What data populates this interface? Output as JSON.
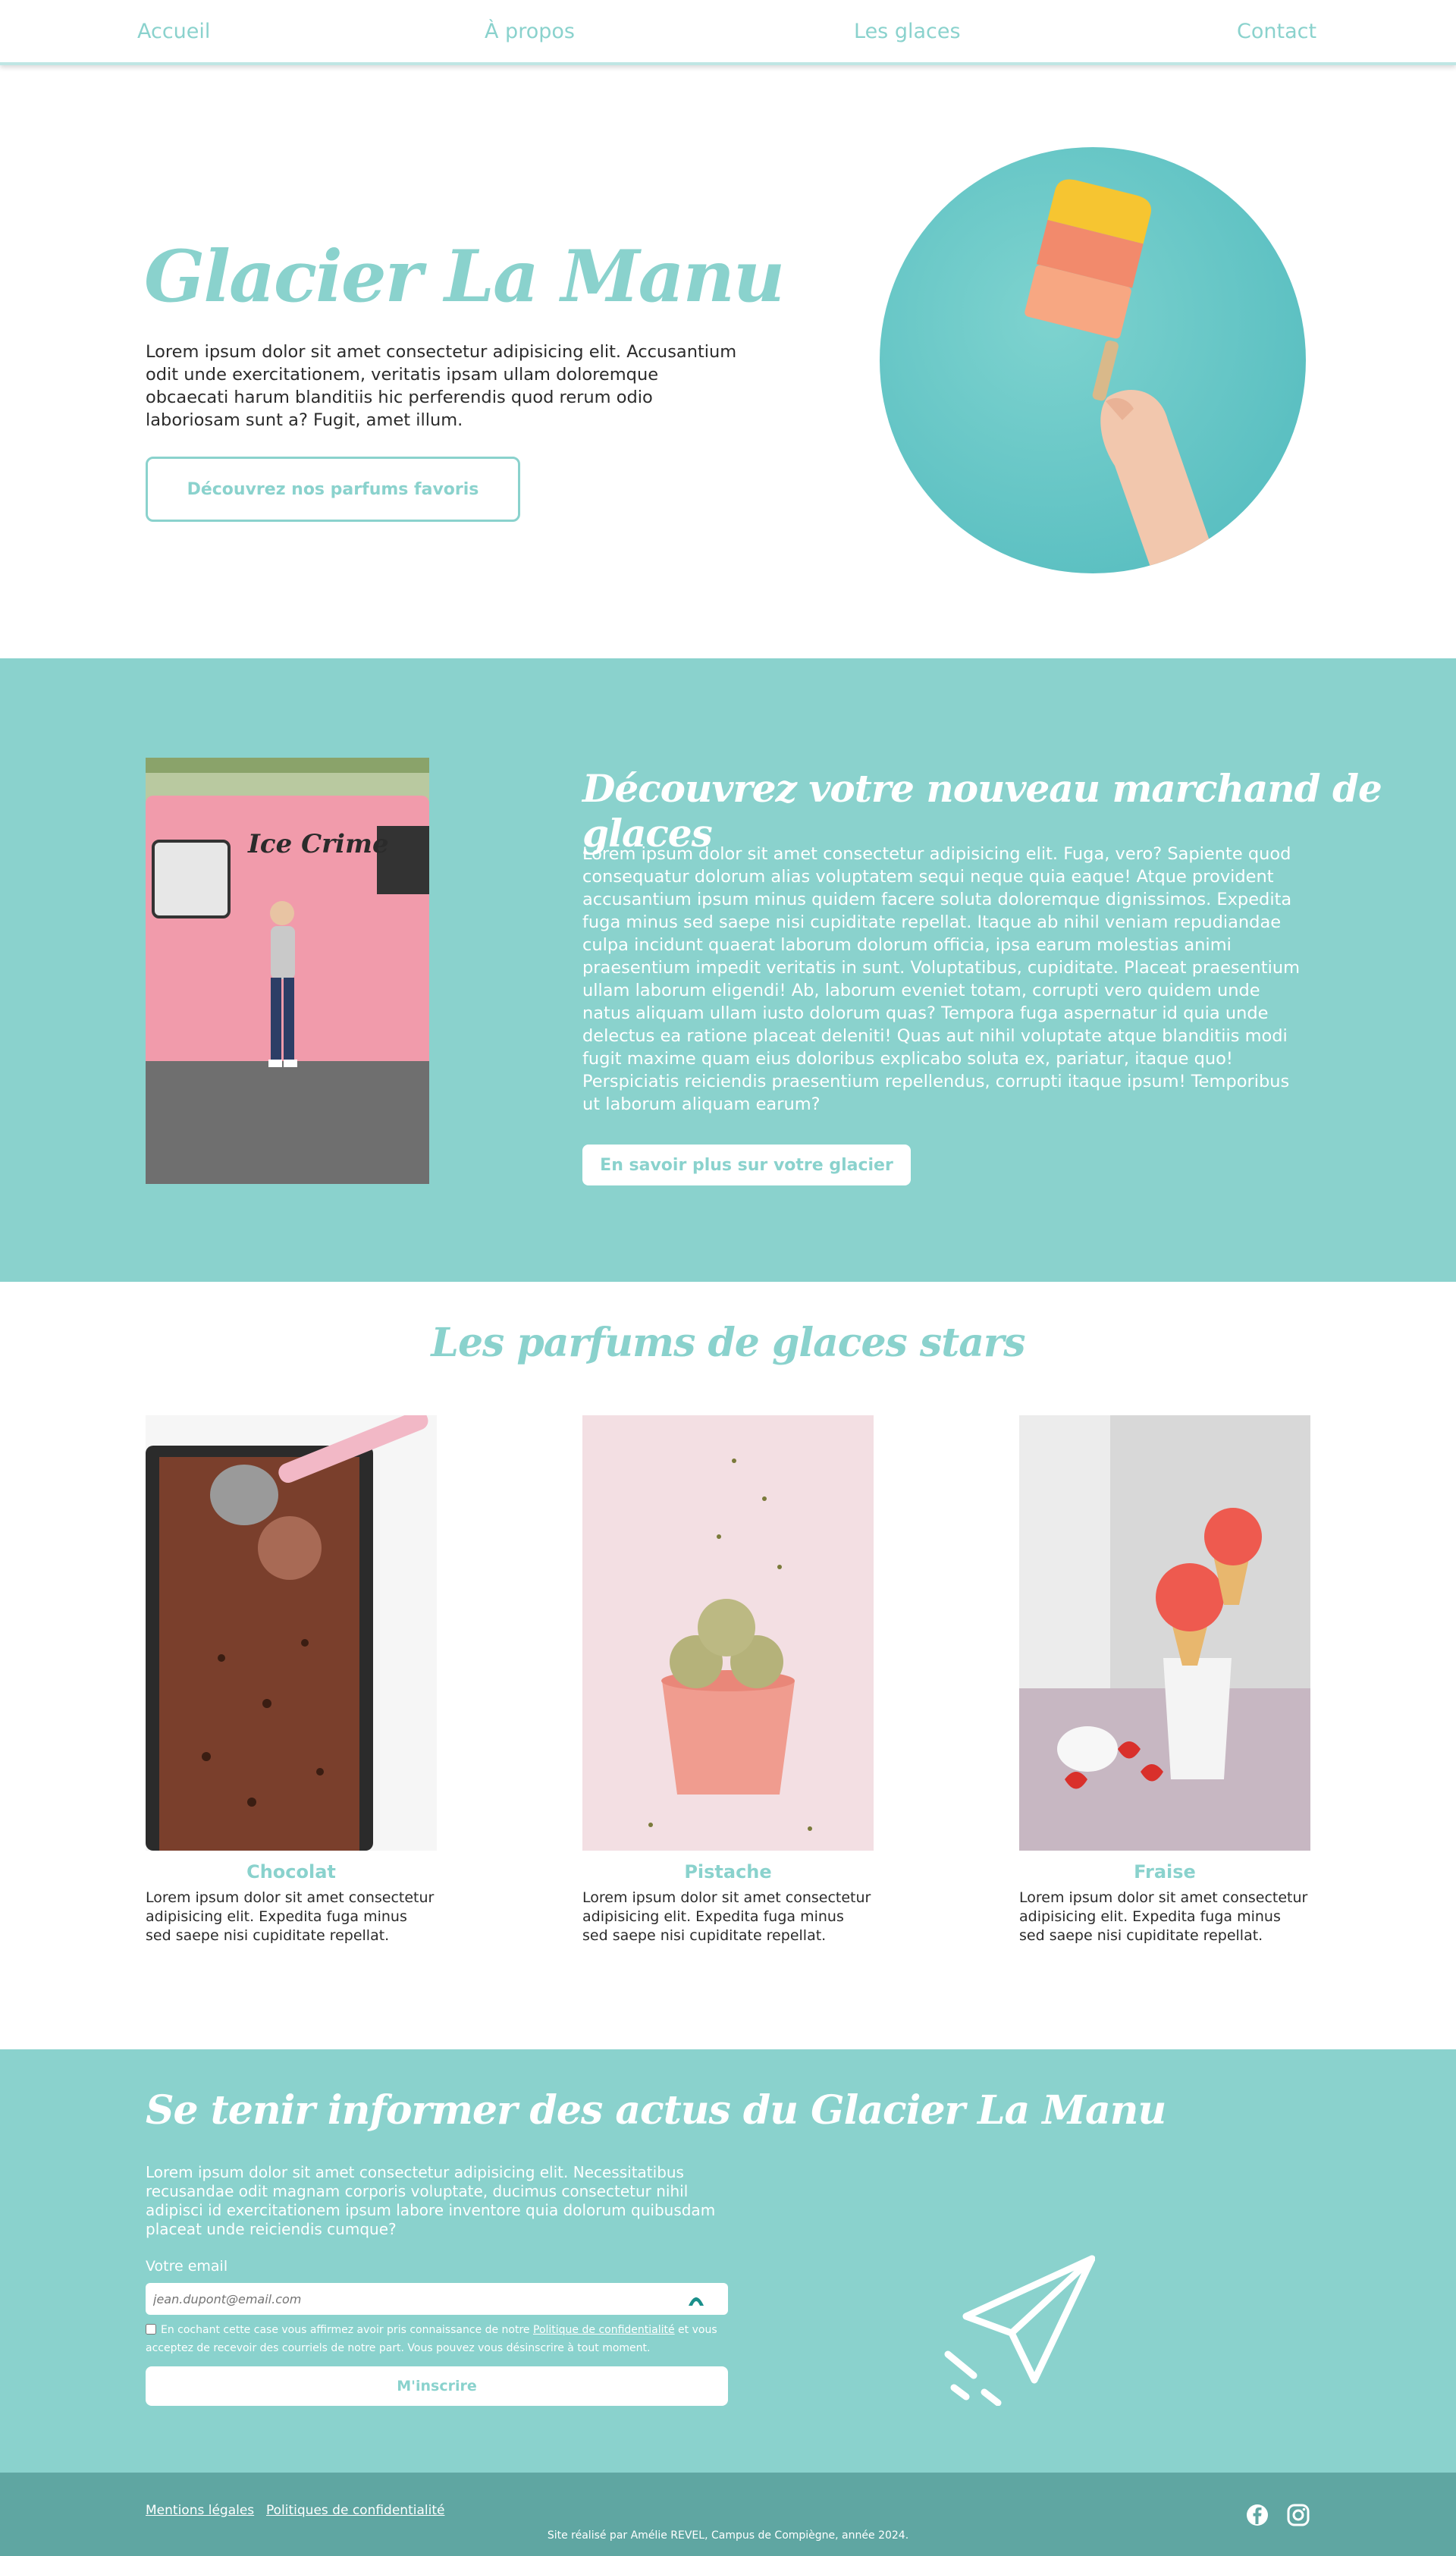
{
  "nav": {
    "items": [
      "Accueil",
      "À propos",
      "Les glaces",
      "Contact"
    ]
  },
  "hero": {
    "title": "Glacier La Manu",
    "text": "Lorem ipsum dolor sit amet consectetur adipisicing elit. Accusantium odit unde exercitationem, veritatis ipsam ullam doloremque obcaecati harum blanditiis hic perferendis quod rerum odio laboriosam sunt a? Fugit, amet illum.",
    "button": "Découvrez nos parfums favoris"
  },
  "about": {
    "title": "Découvrez votre nouveau marchand de glaces",
    "text": "Lorem ipsum dolor sit amet consectetur adipisicing elit. Fuga, vero? Sapiente quod consequatur dolorum alias voluptatem sequi neque quia eaque! Atque provident accusantium ipsum minus quidem facere soluta doloremque dignissimos. Expedita fuga minus sed saepe nisi cupiditate repellat. Itaque ab nihil veniam repudiandae culpa incidunt quaerat laborum dolorum officia, ipsa earum molestias animi praesentium impedit veritatis in sunt. Voluptatibus, cupiditate. Placeat praesentium ullam laborum eligendi! Ab, laborum eveniet totam, corrupti vero quidem unde natus aliquam ullam iusto dolorum quas? Tempora fuga aspernatur id quia unde delectus ea ratione placeat deleniti! Quas aut nihil voluptate atque blanditiis modi fugit maxime quam eius doloribus explicabo soluta ex, pariatur, itaque quo! Perspiciatis reiciendis praesentium repellendus, corrupti itaque ipsum! Temporibus ut laborum aliquam earum?",
    "button": "En savoir plus sur votre glacier",
    "truck_text": "Ice Crime"
  },
  "flavours": {
    "title": "Les parfums de glaces stars",
    "cards": [
      {
        "name": "Chocolat",
        "desc": "Lorem ipsum dolor sit amet consectetur adipisicing elit. Expedita fuga minus sed saepe nisi cupiditate repellat."
      },
      {
        "name": "Pistache",
        "desc": "Lorem ipsum dolor sit amet consectetur adipisicing elit. Expedita fuga minus sed saepe nisi cupiditate repellat."
      },
      {
        "name": "Fraise",
        "desc": "Lorem ipsum dolor sit amet consectetur adipisicing elit. Expedita fuga minus sed saepe nisi cupiditate repellat."
      }
    ]
  },
  "newsletter": {
    "title": "Se tenir informer des actus du Glacier La Manu",
    "text": "Lorem ipsum dolor sit amet consectetur adipisicing elit. Necessitatibus recusandae odit magnam corporis voluptate, ducimus consectetur nihil adipisci id exercitationem ipsum labore inventore quia dolorum quibusdam placeat unde reiciendis cumque?",
    "email_label": "Votre email",
    "email_placeholder": "jean.dupont@email.com",
    "consent_before": "En cochant cette case vous affirmez avoir pris connaissance de notre ",
    "consent_link": "Politique de confidentialité",
    "consent_after": " et vous acceptez de recevoir des courriels de notre part. Vous pouvez vous désinscrire à tout moment.",
    "button": "M'inscrire"
  },
  "footer": {
    "links": [
      "Mentions légales",
      "Politiques de confidentialité"
    ],
    "credit": "Site réalisé par Amélie REVEL, Campus de Compiègne, année 2024.",
    "icons": [
      "facebook-icon",
      "instagram-icon"
    ]
  },
  "colors": {
    "accent": "#8ad2cd",
    "footer": "#5fa6a2"
  }
}
